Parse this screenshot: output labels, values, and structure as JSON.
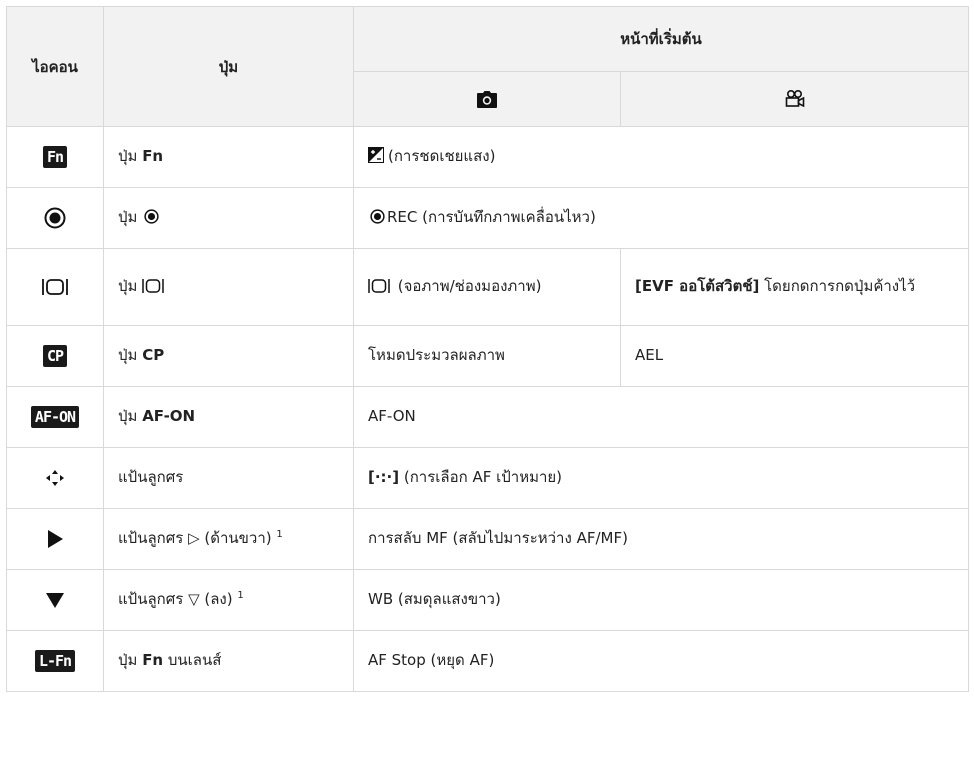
{
  "header": {
    "icon_col": "ไอคอน",
    "button_col": "ปุ่ม",
    "default_function": "หน้าที่เริ่มต้น",
    "photo_mode_icon": "camera-icon",
    "movie_mode_icon": "movie-camera-icon"
  },
  "rows": [
    {
      "icon_text": "Fn",
      "btn_prefix": "ปุ่ม ",
      "btn_bold": "Fn",
      "func": "(การชดเชยแสง)"
    },
    {
      "icon_name": "rec-button-icon",
      "btn_prefix": "ปุ่ม ",
      "func_prefix": "REC",
      "func": " (การบันทึกภาพเคลื่อนไหว)"
    },
    {
      "icon_name": "lv-button-icon",
      "btn_prefix": "ปุ่ม ",
      "func_photo": " (จอภาพ/ช่องมองภาพ)",
      "func_movie_bold": "[EVF ออโต้สวิตช์]",
      "func_movie": " โดยกดการกดปุ่มค้างไว้"
    },
    {
      "icon_text": "CP",
      "btn_prefix": "ปุ่ม ",
      "btn_bold": "CP",
      "func_photo": "โหมดประมวลผลภาพ",
      "func_movie": "AEL"
    },
    {
      "icon_text": "AF-ON",
      "btn_prefix": "ปุ่ม ",
      "btn_bold": "AF-ON",
      "func": "AF-ON"
    },
    {
      "icon_name": "arrow-pad-icon",
      "btn": "แป้นลูกศร",
      "func_bold": "[·:·]",
      "func": " (การเลือก AF เป้าหมาย)"
    },
    {
      "icon_name": "arrow-right-icon",
      "btn_prefix": "แป้นลูกศร ",
      "btn_symbol": "▷",
      "btn_suffix": " (ด้านขวา) ",
      "footnote": "1",
      "func": "การสลับ MF (สลับไปมาระหว่าง AF/MF)"
    },
    {
      "icon_name": "arrow-down-icon",
      "btn_prefix": "แป้นลูกศร ",
      "btn_symbol": "▽",
      "btn_suffix": " (ลง) ",
      "footnote": "1",
      "func": "WB (สมดุลแสงขาว)"
    },
    {
      "icon_text": "L-Fn",
      "btn_prefix": "ปุ่ม ",
      "btn_bold": "Fn",
      "btn_suffix": " บนเลนส์",
      "func": "AF Stop (หยุด AF)"
    }
  ]
}
